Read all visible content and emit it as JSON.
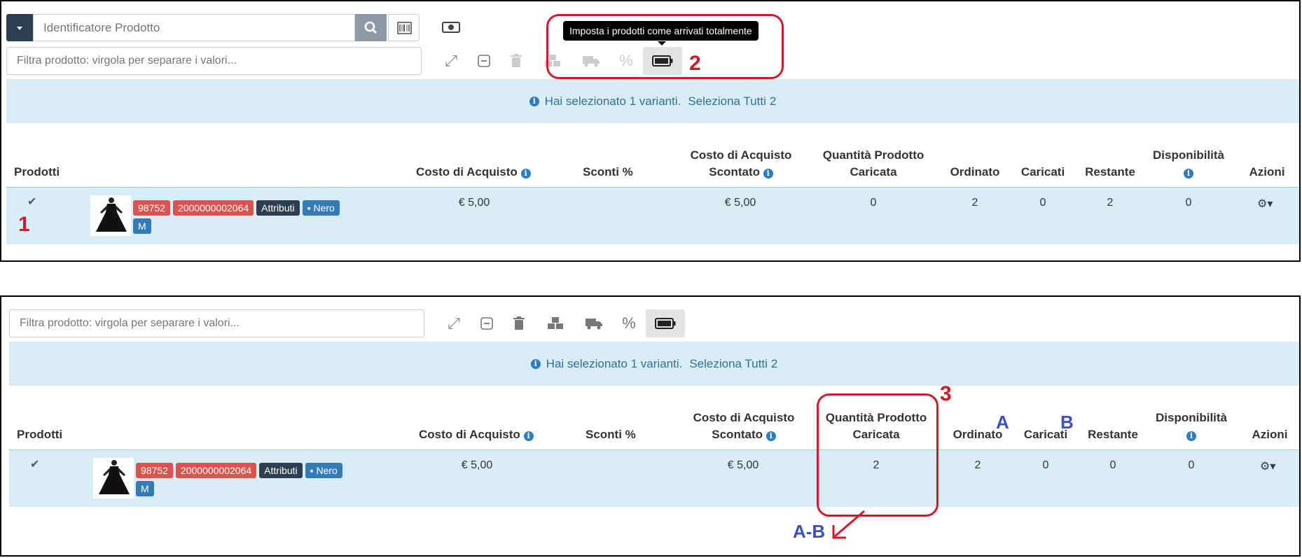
{
  "search": {
    "placeholder": "Identificatore Prodotto"
  },
  "filter": {
    "placeholder": "Filtra prodotto: virgola per separare i valori..."
  },
  "tooltip": {
    "text": "Imposta i prodotti come arrivati totalmente"
  },
  "banner": {
    "text": "Hai selezionato 1 varianti.",
    "select_all": "Seleziona Tutti",
    "select_all_count": "2"
  },
  "columns": {
    "products": "Prodotti",
    "cost": "Costo di Acquisto",
    "discount": "Sconti %",
    "discounted_cost_1": "Costo di Acquisto",
    "discounted_cost_2": "Scontato",
    "qty_loaded_1": "Quantità Prodotto",
    "qty_loaded_2": "Caricata",
    "ordered": "Ordinato",
    "loaded": "Caricati",
    "remaining": "Restante",
    "availability": "Disponibilità",
    "actions": "Azioni"
  },
  "row": {
    "id": "98752",
    "barcode": "2000000002064",
    "attributes": "Attributi",
    "color": "Nero",
    "size": "M",
    "cost": "€ 5,00",
    "discounted_cost": "€ 5,00"
  },
  "before": {
    "qty_loaded": "0",
    "ordered": "2",
    "loaded": "0",
    "remaining": "2",
    "availability": "0"
  },
  "after": {
    "qty_loaded": "2",
    "ordered": "2",
    "loaded": "0",
    "remaining": "0",
    "availability": "0"
  },
  "annotations": {
    "n1": "1",
    "n2": "2",
    "n3": "3",
    "a": "A",
    "b": "B",
    "ab": "A-B"
  },
  "colors": {
    "annotation_red": "#d0192a",
    "annotation_blue": "#3b4fc4",
    "row_bg": "#d9edf7",
    "label_red": "#d9534f",
    "label_dark": "#2d3e50",
    "label_blue": "#337ab7"
  }
}
